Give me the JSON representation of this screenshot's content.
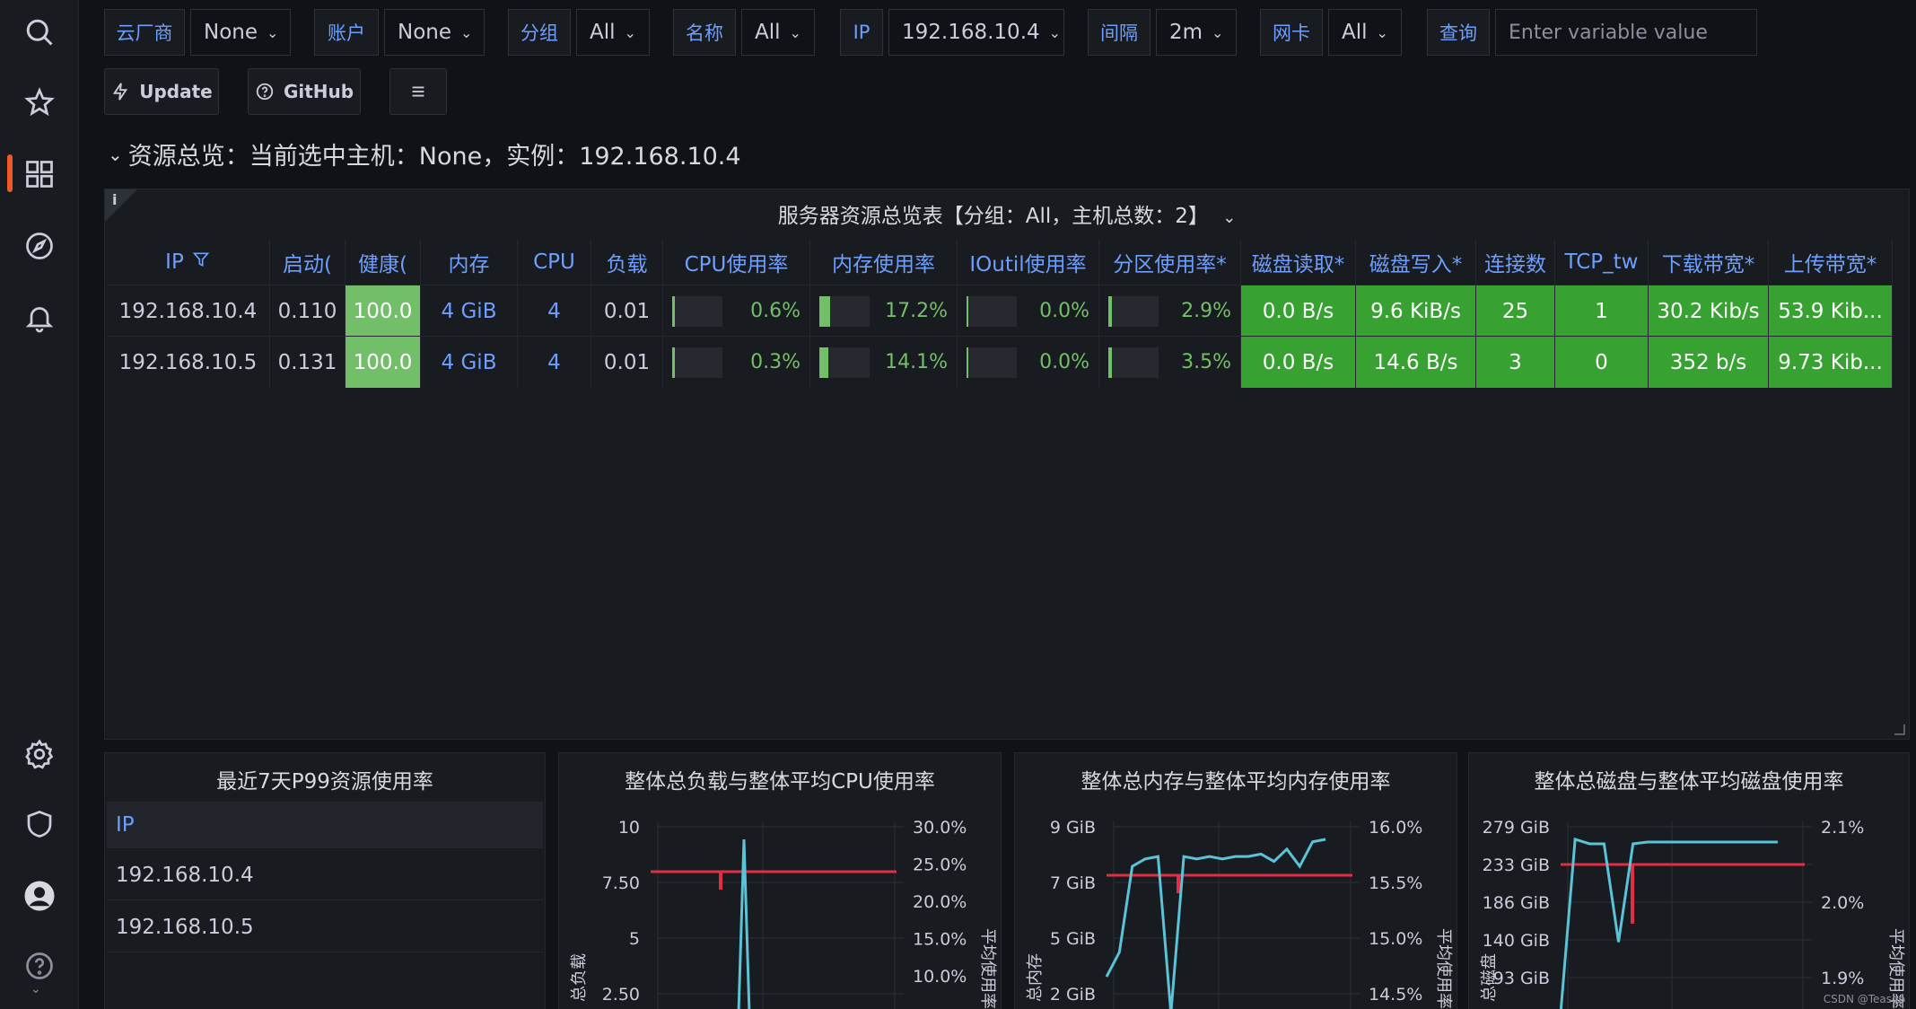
{
  "variables": [
    {
      "label": "云厂商",
      "value": "None"
    },
    {
      "label": "账户",
      "value": "None"
    },
    {
      "label": "分组",
      "value": "All"
    },
    {
      "label": "名称",
      "value": "All"
    },
    {
      "label": "IP",
      "value": "192.168.10.4"
    },
    {
      "label": "间隔",
      "value": "2m"
    },
    {
      "label": "网卡",
      "value": "All"
    }
  ],
  "query": {
    "label": "查询",
    "placeholder": "Enter variable value"
  },
  "toolbar": {
    "update_label": "Update",
    "github_label": "GitHub"
  },
  "row_title": "资源总览：当前选中主机：None，实例：192.168.10.4",
  "table": {
    "title": "服务器资源总览表【分组：All，主机总数：2】",
    "columns": [
      "IP",
      "启动(",
      "健康(",
      "内存",
      "CPU",
      "负载",
      "CPU使用率",
      "内存使用率",
      "IOutil使用率",
      "分区使用率*",
      "磁盘读取*",
      "磁盘写入*",
      "连接数",
      "TCP_tw",
      "下载带宽*",
      "上传带宽*"
    ],
    "rows": [
      {
        "ip": "192.168.10.4",
        "uptime": "0.110",
        "health": "100.0",
        "mem": "4 GiB",
        "cpu": "4",
        "load": "0.01",
        "cpu_use": "0.6%",
        "cpu_use_pct": 0.6,
        "mem_use": "17.2%",
        "mem_use_pct": 17.2,
        "io_use": "0.0%",
        "io_use_pct": 0.0,
        "part_use": "2.9%",
        "part_use_pct": 2.9,
        "disk_read": "0.0 B/s",
        "disk_write": "9.6 KiB/s",
        "conn": "25",
        "tcp_tw": "1",
        "down": "30.2 Kib/s",
        "up": "53.9 Kib..."
      },
      {
        "ip": "192.168.10.5",
        "uptime": "0.131",
        "health": "100.0",
        "mem": "4 GiB",
        "cpu": "4",
        "load": "0.01",
        "cpu_use": "0.3%",
        "cpu_use_pct": 0.3,
        "mem_use": "14.1%",
        "mem_use_pct": 14.1,
        "io_use": "0.0%",
        "io_use_pct": 0.0,
        "part_use": "3.5%",
        "part_use_pct": 3.5,
        "disk_read": "0.0 B/s",
        "disk_write": "14.6 B/s",
        "conn": "3",
        "tcp_tw": "0",
        "down": "352 b/s",
        "up": "9.73 Kib..."
      }
    ]
  },
  "p99_panel": {
    "title": "最近7天P99资源使用率",
    "header": "IP",
    "rows": [
      "192.168.10.4",
      "192.168.10.5"
    ]
  },
  "chart_data": [
    {
      "type": "line",
      "title": "整体总负载与整体平均CPU使用率",
      "ylabel": "总负载",
      "ylabel_right": "平均使用率",
      "y_ticks": [
        "10",
        "7.50",
        "5",
        "2.50"
      ],
      "y_right_ticks": [
        "30.0%",
        "25.0%",
        "20.0%",
        "15.0%",
        "10.0%"
      ],
      "series": [
        {
          "color": "#e02f44",
          "values": [
            8.0,
            8.0,
            8.0,
            8.0,
            8.0,
            8.0,
            8.0,
            8.0,
            8.0,
            8.0,
            8.0,
            8.0,
            8.0,
            8.0,
            8.0,
            8.0,
            8.0,
            8.0,
            8.0,
            8.0
          ]
        },
        {
          "color": "#5ac3d8",
          "values": [
            null,
            null,
            null,
            null,
            0,
            9,
            0,
            null,
            null,
            null,
            null,
            null,
            null,
            null,
            null,
            null,
            null,
            null,
            null,
            null
          ]
        }
      ]
    },
    {
      "type": "line",
      "title": "整体总内存与整体平均内存使用率",
      "ylabel": "总内存",
      "ylabel_right": "平均使用率",
      "y_ticks": [
        "9 GiB",
        "7 GiB",
        "5 GiB",
        "2 GiB"
      ],
      "y_right_ticks": [
        "16.0%",
        "15.5%",
        "15.0%",
        "14.5%"
      ],
      "series": [
        {
          "color": "#e02f44",
          "values": [
            15.55,
            15.55,
            15.55,
            15.55,
            15.55,
            15.55,
            15.55,
            15.55,
            15.55,
            15.55,
            15.55,
            15.55,
            15.55,
            15.55,
            15.55,
            15.55,
            15.55,
            15.55
          ]
        },
        {
          "color": "#5ac3d8",
          "values": [
            2,
            3,
            6.5,
            6.8,
            6.9,
            0.5,
            6.9,
            6.8,
            6.9,
            6.8,
            6.9,
            6.9,
            7,
            6.7,
            7.2,
            6.5,
            7.5,
            7.6
          ]
        }
      ]
    },
    {
      "type": "line",
      "title": "整体总磁盘与整体平均磁盘使用率",
      "ylabel": "总磁盘",
      "ylabel_right": "平均使用率",
      "y_ticks": [
        "279 GiB",
        "233 GiB",
        "186 GiB",
        "140 GiB",
        "93 GiB"
      ],
      "y_right_ticks": [
        "2.1%",
        "2.0%",
        "1.9%"
      ],
      "series": [
        {
          "color": "#e02f44",
          "values": [
            2.03,
            2.03,
            2.03,
            2.03,
            2.03,
            2.03,
            2.03,
            2.03,
            2.03,
            2.03,
            2.03,
            2.03,
            2.03,
            2.03,
            2.03,
            2.03
          ]
        },
        {
          "color": "#5ac3d8",
          "values": [
            80,
            275,
            270,
            270,
            160,
            270,
            272,
            272,
            272,
            272,
            272,
            272,
            272,
            272,
            272,
            272
          ]
        }
      ]
    }
  ],
  "watermark": "CSDN @Teasop"
}
